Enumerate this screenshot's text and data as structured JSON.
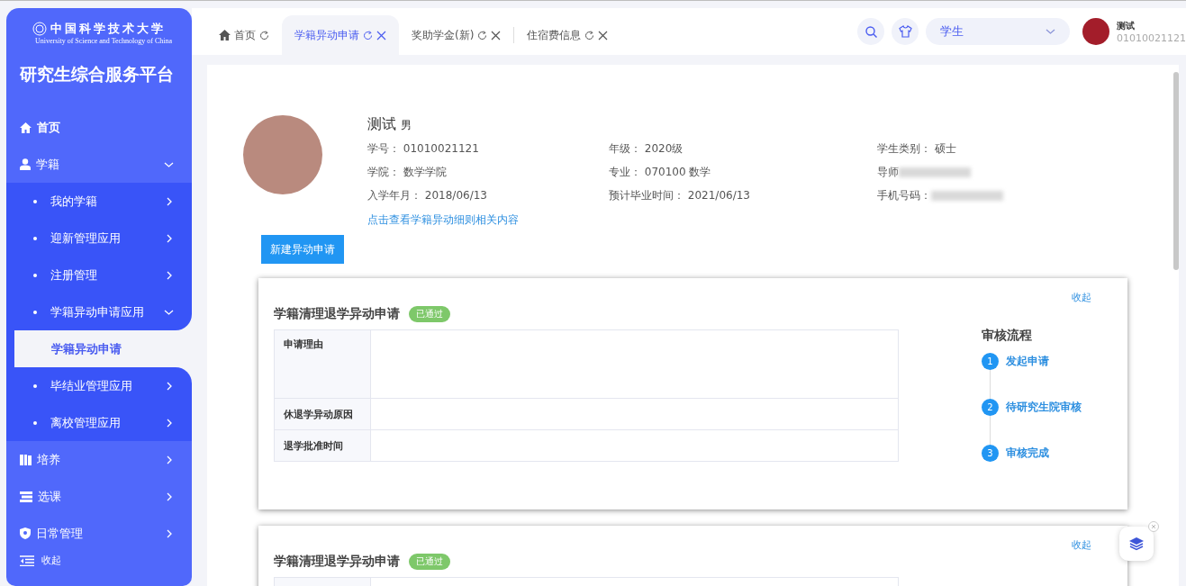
{
  "sidebar": {
    "logo_text": "中国科学技术大学",
    "logo_subtitle": "University of Science and Technology of China",
    "title": "研究生综合服务平台",
    "items": [
      {
        "label": "首页",
        "selected": false
      },
      {
        "label": "学籍",
        "selected": false,
        "expanded": true,
        "children": [
          {
            "label": "我的学籍",
            "selected": false,
            "expanded": false
          },
          {
            "label": "迎新管理应用",
            "selected": false,
            "expanded": false
          },
          {
            "label": "注册管理",
            "selected": false,
            "expanded": false
          },
          {
            "label": "学籍异动申请应用",
            "selected": false,
            "expanded": true,
            "children": [
              {
                "label": "学籍异动申请",
                "selected": true
              }
            ]
          },
          {
            "label": "毕结业管理应用",
            "selected": false,
            "expanded": false
          },
          {
            "label": "离校管理应用",
            "selected": false,
            "expanded": false
          }
        ]
      },
      {
        "label": "培养",
        "selected": false,
        "expanded": false
      },
      {
        "label": "选课",
        "selected": false,
        "expanded": false
      },
      {
        "label": "日常管理",
        "selected": false,
        "expanded": false
      }
    ],
    "collapse": "收起"
  },
  "tabs": [
    {
      "label": "首页",
      "selected": false,
      "closable": false
    },
    {
      "label": "学籍异动申请",
      "selected": true,
      "closable": true
    },
    {
      "label": "奖助学金(新)",
      "selected": false,
      "closable": true
    },
    {
      "label": "住宿费信息",
      "selected": false,
      "closable": true
    }
  ],
  "header": {
    "role": "学生",
    "user_name": "测试",
    "user_id": "01010021121"
  },
  "profile": {
    "name": "测试",
    "gender": "男",
    "fields": [
      {
        "label": "学号：",
        "value": "01010021121"
      },
      {
        "label": "年级：",
        "value": "2020级"
      },
      {
        "label": "学生类别：",
        "value": "硕士"
      },
      {
        "label": "学院：",
        "value": "数学学院"
      },
      {
        "label": "专业：",
        "value": "070100 数学"
      },
      {
        "label": "导师",
        "redacted": true
      },
      {
        "label": "入学年月：",
        "value": "2018/06/13"
      },
      {
        "label": "预计毕业时间：",
        "value": "2021/06/13"
      },
      {
        "label": "手机号码：",
        "redacted": true
      }
    ],
    "link": "点击查看学籍异动细则相关内容",
    "new_button": "新建异动申请"
  },
  "cards": [
    {
      "title": "学籍清理退学异动申请",
      "status": "已通过",
      "collapse": "收起",
      "rows": [
        {
          "label": "申请理由",
          "kind": "tall"
        },
        {
          "label": "休退学异动原因",
          "kind": "normal"
        },
        {
          "label": "退学批准时间",
          "kind": "normal"
        }
      ],
      "flow": {
        "title": "审核流程",
        "steps": [
          {
            "number": "1",
            "label": "发起申请"
          },
          {
            "number": "2",
            "label": "待研究生院审核"
          },
          {
            "number": "3",
            "label": "审核完成"
          }
        ]
      }
    },
    {
      "title": "学籍清理退学异动申请",
      "status": "已通过",
      "collapse": "收起"
    }
  ]
}
